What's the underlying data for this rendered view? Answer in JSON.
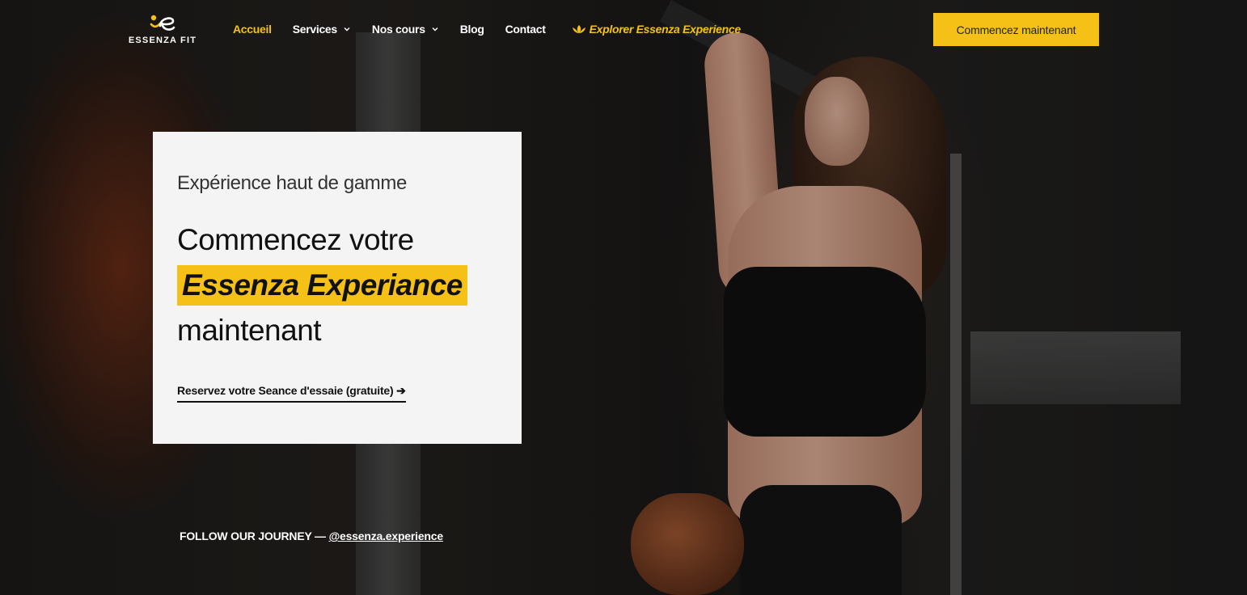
{
  "brand": {
    "name": "ESSENZA FIT",
    "logo_icon": "essenza-e-logo-icon",
    "accent_color": "#f5c116"
  },
  "nav": {
    "items": [
      {
        "label": "Accueil",
        "active": true
      },
      {
        "label": "Services",
        "has_dropdown": true
      },
      {
        "label": "Nos cours",
        "has_dropdown": true
      },
      {
        "label": "Blog"
      },
      {
        "label": "Contact"
      }
    ],
    "explore": {
      "label": "Explorer Essenza Experience",
      "icon": "lotus-icon"
    }
  },
  "header_cta": {
    "label": "Commencez maintenant"
  },
  "hero": {
    "eyebrow": "Expérience haut de gamme",
    "headline_line1": "Commencez votre",
    "headline_highlight": "Essenza Experiance",
    "headline_line3": "maintenant",
    "trial_link": "Reservez votre Seance d'essaie (gratuite) ➔"
  },
  "social": {
    "prefix": "FOLLOW OUR JOURNEY — ",
    "handle": "@essenza.experience"
  }
}
